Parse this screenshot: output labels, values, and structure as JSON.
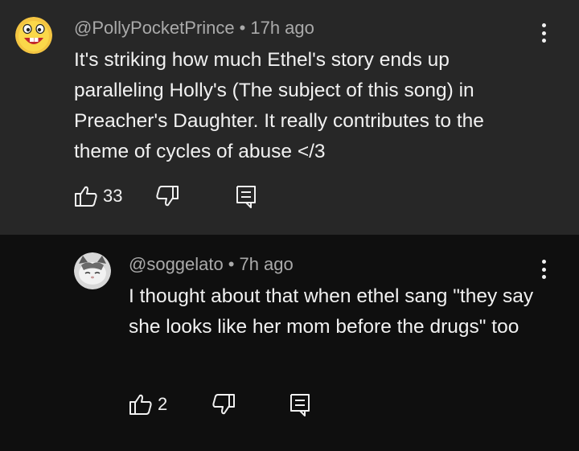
{
  "comments": [
    {
      "author": "@PollyPocketPrince",
      "separator": "•",
      "time": "17h ago",
      "text": "It's striking how much Ethel's story ends up paralleling Holly's (The subject of this song) in Preacher's Daughter. It really contributes to the theme of cycles of abuse </3",
      "likes": "33",
      "avatar_icon": "smiley-face-avatar"
    },
    {
      "author": "@soggelato",
      "separator": "•",
      "time": "7h ago",
      "text": "I thought about that when ethel sang \"they say she looks like her mom before the drugs\" too",
      "likes": "2",
      "avatar_icon": "cat-avatar"
    }
  ],
  "colors": {
    "top_background": "#272727",
    "reply_background": "#0f0f0f",
    "text": "#f1f1f1",
    "meta_text": "#aaaaaa"
  }
}
